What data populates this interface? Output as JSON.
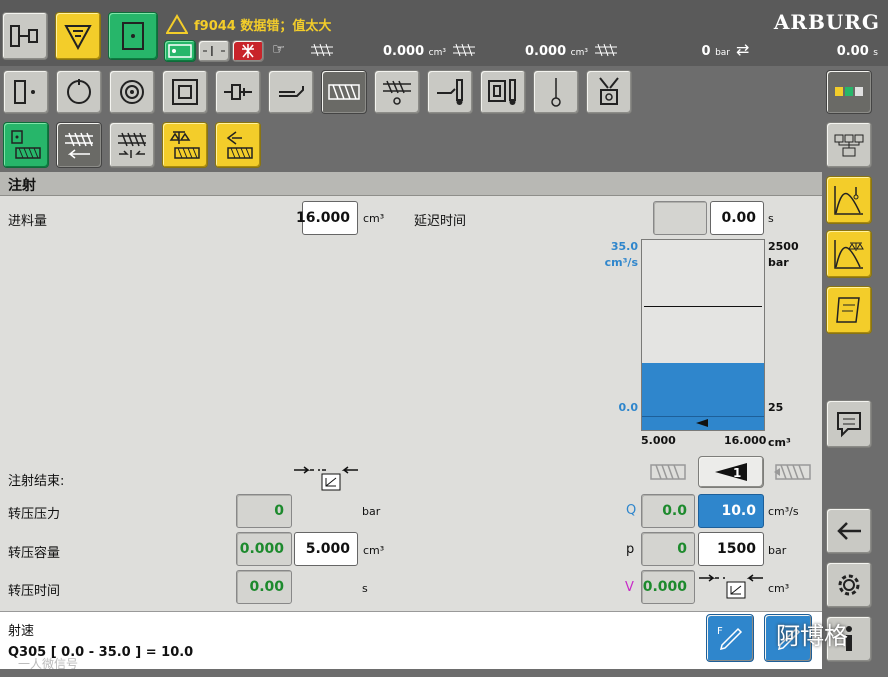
{
  "header": {
    "alarm": "f9044 数据错；值太大",
    "brand": "ARBURG",
    "status": [
      {
        "value": "0.000",
        "unit": "cm³"
      },
      {
        "value": "0.000",
        "unit": "cm³"
      },
      {
        "value": "0",
        "unit": "bar"
      },
      {
        "value": "0.00",
        "unit": "s"
      }
    ]
  },
  "section_title": "注射",
  "dosing": {
    "label": "进料量",
    "value": "16.000",
    "unit": "cm³"
  },
  "delay": {
    "label": "延迟时间",
    "value": "0.00",
    "unit": "s"
  },
  "chart": {
    "y_left_top": "35.0",
    "y_left_unit": "cm³/s",
    "y_right_top": "2500",
    "y_right_unit": "bar",
    "y_left_bottom": "0.0",
    "y_right_bottom": "25",
    "x_left": "5.000",
    "x_right": "16.000",
    "x_unit": "cm³",
    "fill_fraction": 0.3,
    "line_fraction": 0.62
  },
  "inj_end": {
    "label": "注射结束:"
  },
  "step_number": "1",
  "switch_pressure": {
    "label": "转压压力",
    "actual": "0",
    "unit": "bar"
  },
  "switch_volume": {
    "label": "转压容量",
    "actual": "0.000",
    "value": "5.000",
    "unit": "cm³"
  },
  "switch_time": {
    "label": "转压时间",
    "actual": "0.00",
    "unit": "s"
  },
  "profile": {
    "q": {
      "label": "Q",
      "actual": "0.0",
      "value": "10.0",
      "unit": "cm³/s"
    },
    "p": {
      "label": "p",
      "actual": "0",
      "value": "1500",
      "unit": "bar"
    },
    "v": {
      "label": "V",
      "actual": "0.000",
      "unit": "cm³"
    }
  },
  "footer": {
    "title": "射速",
    "param": "Q305 [ 0.0 - 35.0 ] = 10.0",
    "watermark_left": "一人微信号",
    "watermark_right": "阿博格"
  }
}
